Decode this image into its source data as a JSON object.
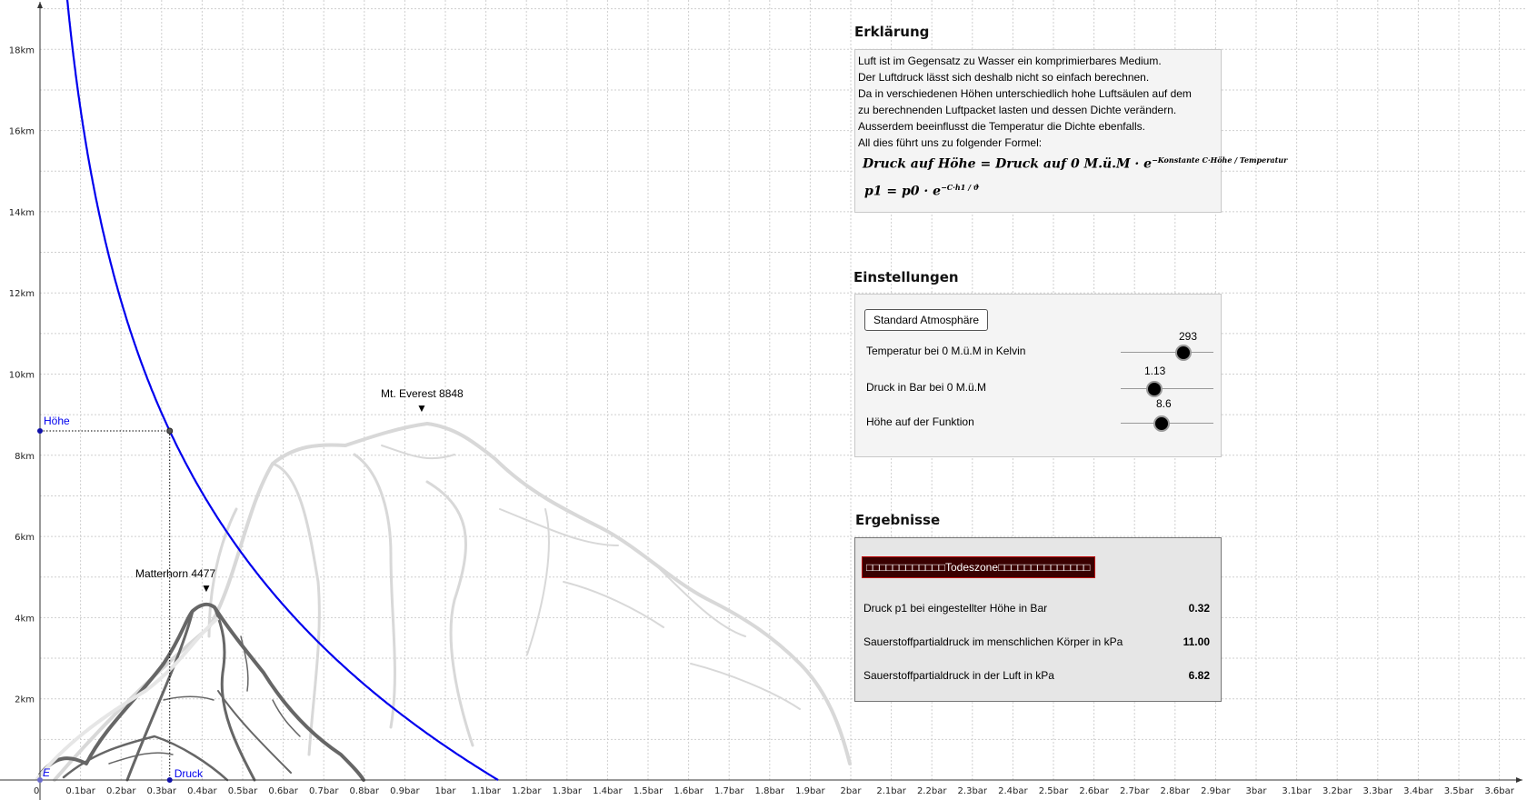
{
  "graph": {
    "x_ticks": [
      "0",
      "0.1bar",
      "0.2bar",
      "0.3bar",
      "0.4bar",
      "0.5bar",
      "0.6bar",
      "0.7bar",
      "0.8bar",
      "0.9bar",
      "1bar",
      "1.1bar",
      "1.2bar",
      "1.3bar",
      "1.4bar",
      "1.5bar",
      "1.6bar",
      "1.7bar",
      "1.8bar",
      "1.9bar",
      "2bar",
      "2.1bar",
      "2.2bar",
      "2.3bar",
      "2.4bar",
      "2.5bar",
      "2.6bar",
      "2.7bar",
      "2.8bar",
      "2.9bar",
      "3bar",
      "3.1bar",
      "3.2bar",
      "3.3bar",
      "3.4bar",
      "3.5bar",
      "3.6bar"
    ],
    "y_ticks": [
      "2km",
      "4km",
      "6km",
      "8km",
      "10km",
      "12km",
      "14km",
      "16km",
      "18km"
    ],
    "point_hoehe_label": "Höhe",
    "point_druck_label": "Druck",
    "point_e_label": "E",
    "everest_label": "Mt. Everest 8848",
    "matterhorn_label": "Matterhorn 4477",
    "marker_glyph": "▼",
    "curve_color": "#0000ee",
    "height_km": 8.6,
    "pressure_at_height_bar": 0.32
  },
  "explanation": {
    "title": "Erklärung",
    "lines": [
      "Luft ist im Gegensatz zu Wasser ein komprimierbares Medium.",
      "Der Luftdruck lässt sich deshalb nicht so einfach berechnen.",
      "Da in verschiedenen Höhen unterschiedlich hohe Luftsäulen auf dem",
      "zu berechnenden Luftpacket lasten und dessen Dichte verändern.",
      "Ausserdem beeinflusst die Temperatur die Dichte ebenfalls.",
      "All dies führt uns zu folgender Formel:"
    ],
    "formula1_main": "Druck auf Höhe  = Druck auf 0 M.ü.M  ·  e",
    "formula1_exp": "−Konstante C·Höhe / Temperatur",
    "formula2_main": "p1 = p0  ·  e",
    "formula2_exp": "−C·h1 / ϑ"
  },
  "settings": {
    "title": "Einstellungen",
    "button_label": "Standard Atmosphäre",
    "sliders": [
      {
        "label": "Temperatur bei 0 M.ü.M in Kelvin",
        "value": "293",
        "fraction": 0.68
      },
      {
        "label": "Druck in Bar bei 0 M.ü.M",
        "value": "1.13",
        "fraction": 0.36
      },
      {
        "label": "Höhe auf der Funktion",
        "value": "8.6",
        "fraction": 0.44
      }
    ]
  },
  "results": {
    "title": "Ergebnisse",
    "zone_label": "Todeszone",
    "zone_boxes_left": "□□□□□□□□□□□□",
    "zone_boxes_right": "□□□□□□□□□□□□□□",
    "rows": [
      {
        "label": "Druck p1 bei eingestellter Höhe in Bar",
        "value": "0.32"
      },
      {
        "label": "Sauerstoffpartialdruck im menschlichen Körper in kPa",
        "value": "11.00"
      },
      {
        "label": "Sauerstoffpartialdruck in der Luft in kPa",
        "value": "6.82"
      }
    ]
  }
}
